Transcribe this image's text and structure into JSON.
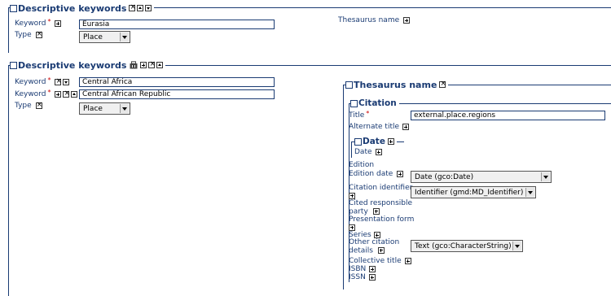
{
  "section1": {
    "title": "Descriptive keywords",
    "keyword_label": "Keyword",
    "keyword_value": "Eurasia",
    "type_label": "Type",
    "type_value": "Place",
    "thesaurus_label": "Thesaurus name"
  },
  "section2": {
    "title": "Descriptive keywords",
    "keyword_label": "Keyword",
    "keyword1_value": "Central Africa",
    "keyword2_value": "Central African Republic",
    "type_label": "Type",
    "type_value": "Place"
  },
  "thesaurus": {
    "title": "Thesaurus name",
    "citation": {
      "title": "Citation",
      "title_label": "Title",
      "title_value": "external.place.regions",
      "alternate_title_label": "Alternate title",
      "date": {
        "title": "Date",
        "date_label": "Date"
      },
      "edition_label": "Edition",
      "edition_date_label": "Edition date",
      "edition_date_value": "Date (gco:Date)",
      "citation_identifier_label_1": "Citation identifier",
      "citation_identifier_value": "Identifier (gmd:MD_Identifier)",
      "cited_party_label_1": "Cited responsible",
      "cited_party_label_2": "party",
      "presentation_form_label": "Presentation form",
      "series_label": "Series",
      "other_details_label_1": "Other citation",
      "other_details_label_2": "details",
      "other_details_value": "Text (gco:CharacterString)",
      "collective_title_label": "Collective title",
      "isbn_label": "ISBN",
      "issn_label": "ISSN"
    }
  }
}
